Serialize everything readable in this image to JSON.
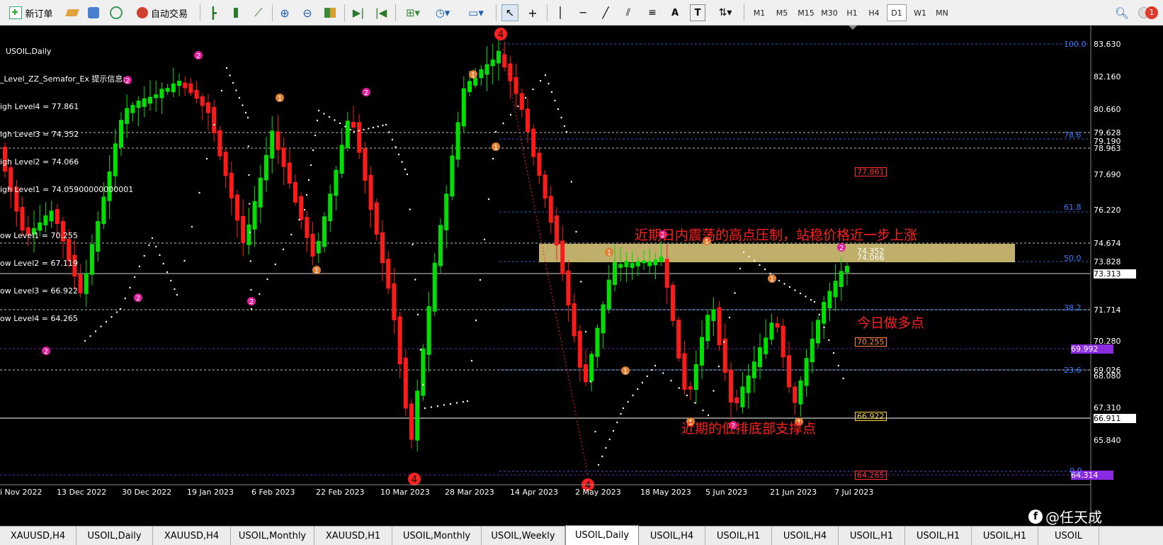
{
  "toolbar": {
    "new_order": "新订单",
    "auto_trade": "自动交易",
    "timeframes": [
      "M1",
      "M5",
      "M15",
      "M30",
      "H1",
      "H4",
      "D1",
      "W1",
      "MN"
    ],
    "active_timeframe": "D1",
    "tools_text": [
      "A",
      "T"
    ],
    "notif_count": "1",
    "icons": [
      "new-order-icon",
      "gold-icon",
      "market-watch-icon",
      "signal-icon",
      "autotrade-icon",
      "bar-chart-icon",
      "candle-chart-icon",
      "line-chart-icon",
      "zoom-in-icon",
      "zoom-out-icon",
      "tile-icon",
      "autoscroll-icon",
      "chart-shift-icon",
      "indicators-icon",
      "periods-icon",
      "templates-icon",
      "cursor-icon",
      "crosshair-icon",
      "vline-icon",
      "hline-icon",
      "trendline-icon",
      "fibo-icon",
      "text-icon",
      "label-icon",
      "arrows-icon",
      "search-icon",
      "notification-icon"
    ]
  },
  "chart": {
    "symbol_title": "USOIL,Daily",
    "info_lines": [
      "_Level_ZZ_Semafor_Ex 提示信息:",
      "igh Level4 = 77.861",
      "igh Level3 = 74.352",
      "igh Level2 = 74.066",
      "igh Level1 = 74.05900000000001",
      "",
      "ow Level1 = 70.255",
      "ow Level2 = 67.119",
      "ow Level3 = 66.922",
      "ow Level4 = 64.265"
    ],
    "price_labels": [
      "83.630",
      "82.160",
      "80.660",
      "79.628",
      "79.190",
      "78.963",
      "77.690",
      "76.220",
      "74.674",
      "73.828",
      "73.313",
      "71.714",
      "70.280",
      "69.992",
      "69.026",
      "68.080",
      "67.310",
      "66.911",
      "65.840",
      "64.314"
    ],
    "fib_levels": [
      "100.0",
      "78.6",
      "61.8",
      "50.0",
      "38.2",
      "23.6",
      "0.0"
    ],
    "level_boxes": [
      "77.861",
      "74.352",
      "74.066",
      "70.255",
      "66.922",
      "64.265"
    ],
    "date_labels": [
      "i Nov 2022",
      "13 Dec 2022",
      "30 Dec 2022",
      "19 Jan 2023",
      "6 Feb 2023",
      "22 Feb 2023",
      "10 Mar 2023",
      "28 Mar 2023",
      "14 Apr 2023",
      "2 May 2023",
      "18 May 2023",
      "5 Jun 2023",
      "21 Jun 2023",
      "7 Jul 2023"
    ],
    "notes": {
      "resistance": "近期日内震荡的高点压制，站稳价格近一步上涨",
      "buy": "今日做多点",
      "support": "近期的低排底部支撑点"
    },
    "semafor_markers": [
      "1",
      "2",
      "4"
    ],
    "watermark": "@任天成",
    "watermark_icon": "f",
    "colors": {
      "bull": "#00e000",
      "bear": "#ff1a1a",
      "fib": "#3a78ff",
      "zone": "#d9c77a",
      "note": "#ff1e1e",
      "background": "#000000"
    }
  },
  "tabs": [
    "XAUUSD,H4",
    "USOIL,Daily",
    "XAUUSD,H4",
    "USOIL,Monthly",
    "XAUUSD,H1",
    "USOIL,Monthly",
    "USOIL,Weekly",
    "USOIL,Daily",
    "USOIL,H4",
    "USOIL,H1",
    "USOIL,H4",
    "USOIL,H1",
    "USOIL,H1",
    "USOIL,H1",
    "USOIL"
  ],
  "active_tab": "USOIL,Daily"
}
